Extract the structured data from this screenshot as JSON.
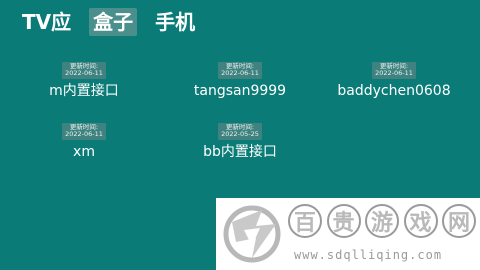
{
  "tabs": [
    {
      "label": "TV应"
    },
    {
      "label": "盒子",
      "active": true
    },
    {
      "label": "手机"
    }
  ],
  "sources": [
    {
      "update_label": "更新时间:",
      "date": "2022-06-11",
      "name": "m内置接口"
    },
    {
      "update_label": "更新时间:",
      "date": "2022-06-11",
      "name": "tangsan9999"
    },
    {
      "update_label": "更新时间:",
      "date": "2022-06-11",
      "name": "baddychen0608"
    },
    {
      "update_label": "更新时间:",
      "date": "2022-06-11",
      "name": "xm"
    },
    {
      "update_label": "更新时间:",
      "date": "2022-05-25",
      "name": "bb内置接口"
    }
  ],
  "watermark": {
    "title_chars": [
      "百",
      "贵",
      "游",
      "戏",
      "网"
    ],
    "url": "www.sdqlliqing.com"
  },
  "colors": {
    "background": "#0b7b77",
    "active_tab": "#4b8f8c",
    "badge": "#3f827f"
  }
}
